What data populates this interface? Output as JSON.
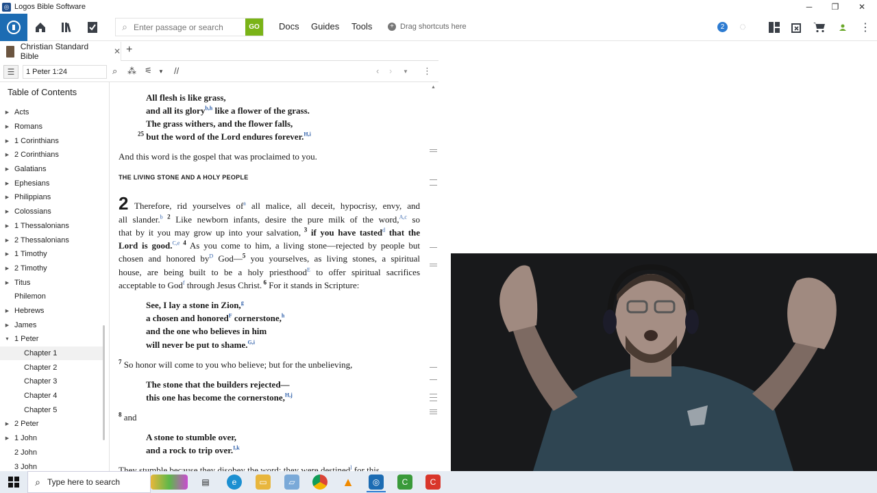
{
  "window": {
    "title": "Logos Bible Software",
    "minimize": "─",
    "restore": "❐",
    "close": "✕"
  },
  "toolbar": {
    "search_placeholder": "Enter passage or search",
    "go_label": "GO",
    "menu": [
      "Docs",
      "Guides",
      "Tools"
    ],
    "shortcut_hint": "Drag shortcuts here",
    "notification_count": "2"
  },
  "tab": {
    "label": "Christian Standard Bible",
    "close": "✕",
    "add": "+"
  },
  "panel": {
    "reference": "1 Peter 1:24",
    "parallel": "//"
  },
  "toc": {
    "title": "Table of Contents",
    "items": [
      {
        "label": "Acts",
        "arrow": "▶"
      },
      {
        "label": "Romans",
        "arrow": "▶"
      },
      {
        "label": "1 Corinthians",
        "arrow": "▶"
      },
      {
        "label": "2 Corinthians",
        "arrow": "▶"
      },
      {
        "label": "Galatians",
        "arrow": "▶"
      },
      {
        "label": "Ephesians",
        "arrow": "▶"
      },
      {
        "label": "Philippians",
        "arrow": "▶"
      },
      {
        "label": "Colossians",
        "arrow": "▶"
      },
      {
        "label": "1 Thessalonians",
        "arrow": "▶"
      },
      {
        "label": "2 Thessalonians",
        "arrow": "▶"
      },
      {
        "label": "1 Timothy",
        "arrow": "▶"
      },
      {
        "label": "2 Timothy",
        "arrow": "▶"
      },
      {
        "label": "Titus",
        "arrow": "▶"
      },
      {
        "label": "Philemon",
        "arrow": ""
      },
      {
        "label": "Hebrews",
        "arrow": "▶"
      },
      {
        "label": "James",
        "arrow": "▶"
      },
      {
        "label": "1 Peter",
        "arrow": "▼"
      },
      {
        "label": "Chapter 1",
        "chapter": true,
        "selected": true
      },
      {
        "label": "Chapter 2",
        "chapter": true
      },
      {
        "label": "Chapter 3",
        "chapter": true
      },
      {
        "label": "Chapter 4",
        "chapter": true
      },
      {
        "label": "Chapter 5",
        "chapter": true
      },
      {
        "label": "2 Peter",
        "arrow": "▶"
      },
      {
        "label": "1 John",
        "arrow": "▶"
      },
      {
        "label": "2 John",
        "arrow": ""
      },
      {
        "label": "3 John",
        "arrow": ""
      }
    ]
  },
  "reader": {
    "l1": "All flesh is like grass,",
    "l2a": "and all its glory",
    "l2s": "b,h",
    "l2b": " like a flower of the grass.",
    "l3": "The grass withers, and the flower falls,",
    "l4v": "25",
    "l4": " but the word of the Lord endures forever.",
    "l4s": "H,i",
    "l5": "And this word is the gospel that was proclaimed to you.",
    "heading": "THE LIVING STONE AND A HOLY PEOPLE",
    "chapter": "2",
    "p1a": "Therefore, rid yourselves of",
    "p1s": "a",
    "p1b": " all malice, all deceit, hypocrisy, envy, and",
    "p2a": "all slander.",
    "p2s": "b",
    "p2v": " 2",
    "p2b": " Like newborn infants, desire the pure milk of the word,",
    "p2s2": "A,c",
    "p2c": " so",
    "p3a": "that by it you may grow up into your salvation,",
    "p3v": " 3",
    "p3b": " if you have tasted",
    "p3s": "d",
    "p3c": " that the",
    "p4a": "Lord is good.",
    "p4s": "C,e",
    "p4v": " 4",
    "p4b": " As you come to him, a living stone—rejected by people but",
    "p5a": "chosen and honored by",
    "p5s": "D",
    "p5b": " God—",
    "p5v": "5",
    "p5c": " you yourselves, as living stones, a spiritual",
    "p6a": "house, are being built to be a holy priesthood",
    "p6s": "E",
    "p6b": " to offer spiritual sacrifices",
    "p7a": "acceptable to God",
    "p7s": "f",
    "p7b": " through Jesus Christ.",
    "p7v": " 6",
    "p7c": " For it stands in Scripture:",
    "q1": "See, I lay a stone in Zion,",
    "q1s": "g",
    "q2": "a chosen and honored",
    "q2s": "F",
    "q2b": " cornerstone,",
    "q2s2": "h",
    "q3": "and the one who believes in him",
    "q4": "will never be put to shame.",
    "q4s": "G,i",
    "p8v": "7",
    "p8": " So honor will come to you who believe; but for the unbelieving,",
    "q5": "The stone that the builders rejected—",
    "q6": "this one has become the cornerstone,",
    "q6s": "H,j",
    "p9v": "8",
    "p9": " and",
    "q7": "A stone to stumble over,",
    "q8": "and a rock to trip over.",
    "q8s": "I,k",
    "p10": "They stumble because they disobey the word; they were destined",
    "p10s": "l",
    "p10b": " for this."
  },
  "taskbar": {
    "search_placeholder": "Type here to search"
  }
}
